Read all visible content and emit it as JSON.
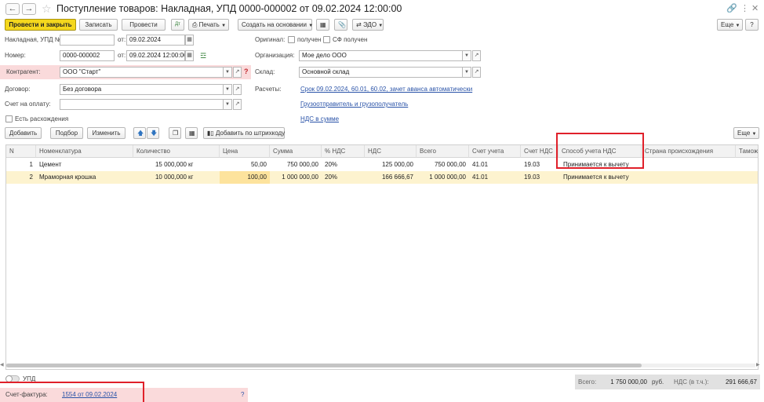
{
  "window": {
    "title": "Поступление товаров: Накладная, УПД 0000-000002 от 09.02.2024 12:00:00"
  },
  "toolbar": {
    "post_and_close": "Провести и закрыть",
    "save": "Записать",
    "post": "Провести",
    "print": "Печать",
    "create_based_on": "Создать на основании",
    "edo": "ЭДО",
    "more": "Еще"
  },
  "form": {
    "invoice_label": "Накладная, УПД №:",
    "invoice_number_value": "",
    "from_label": "от:",
    "invoice_date": "09.02.2024",
    "number_label": "Номер:",
    "number_value": "0000-000002",
    "doc_datetime": "09.02.2024 12:00:00",
    "counterparty_label": "Контрагент:",
    "counterparty_value": "ООО \"Старт\"",
    "contract_label": "Договор:",
    "contract_value": "Без договора",
    "payment_account_label": "Счет на оплату:",
    "payment_account_value": "",
    "discrepancy_label": "Есть расхождения",
    "original_label": "Оригинал:",
    "received_label": "получен",
    "sf_received_label": "СФ получен",
    "organization_label": "Организация:",
    "organization_value": "Мое дело ООО",
    "warehouse_label": "Склад:",
    "warehouse_value": "Основной склад",
    "settlements_label": "Расчеты:",
    "settlements_link": "Срок 09.02.2024, 60.01, 60.02, зачет аванса автоматически",
    "shipper_link": "Грузоотправитель и грузополучатель",
    "vat_link": "НДС в сумме"
  },
  "table_toolbar": {
    "add": "Добавить",
    "pick": "Подбор",
    "edit": "Изменить",
    "add_barcode": "Добавить по штрихкоду",
    "more": "Еще"
  },
  "table": {
    "columns": [
      "N",
      "Номенклатура",
      "Количество",
      "Цена",
      "Сумма",
      "% НДС",
      "НДС",
      "Всего",
      "Счет учета",
      "Счет НДС",
      "Способ учета НДС",
      "Страна происхождения",
      "Тамож"
    ],
    "rows": [
      {
        "n": "1",
        "name": "Цемент",
        "qty": "15 000,000",
        "unit": "кг",
        "price": "50,00",
        "sum": "750 000,00",
        "vat_rate": "20%",
        "vat": "125 000,00",
        "total": "750 000,00",
        "account": "41.01",
        "vat_account": "19.03",
        "vat_method": "Принимается к вычету",
        "country": "",
        "customs": ""
      },
      {
        "n": "2",
        "name": "Мраморная крошка",
        "qty": "10 000,000",
        "unit": "кг",
        "price": "100,00",
        "sum": "1 000 000,00",
        "vat_rate": "20%",
        "vat": "166 666,67",
        "total": "1 000 000,00",
        "account": "41.01",
        "vat_account": "19.03",
        "vat_method": "Принимается к вычету",
        "country": "",
        "customs": ""
      }
    ]
  },
  "footer": {
    "upd_label": "УПД",
    "total_label": "Всего:",
    "total_value": "1 750 000,00",
    "currency": "руб.",
    "vat_label": "НДС (в т.ч.):",
    "vat_value": "291 666,67",
    "invoice_label": "Счет-фактура:",
    "invoice_link": "1554 от 09.02.2024",
    "help": "?"
  },
  "colors": {
    "primary_button": "#f4d71d",
    "highlight_row": "#fdf3cf",
    "price_cell": "#fde39d",
    "required_field_bg": "#fadadb",
    "annotation_red": "#e0202a",
    "link": "#2a53a8"
  }
}
